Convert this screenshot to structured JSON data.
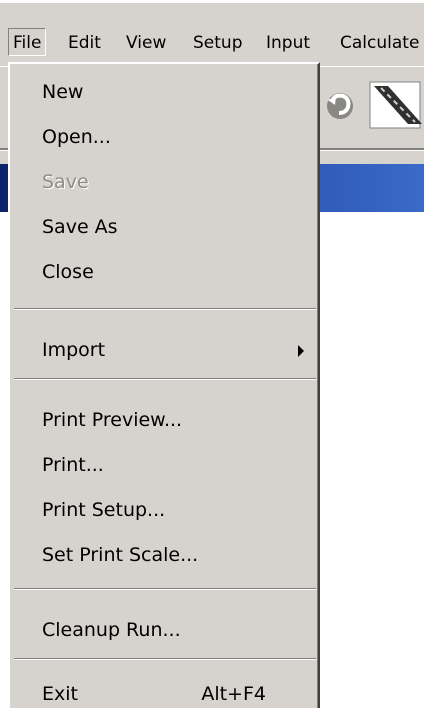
{
  "menubar": {
    "items": [
      {
        "label": "File"
      },
      {
        "label": "Edit"
      },
      {
        "label": "View"
      },
      {
        "label": "Setup"
      },
      {
        "label": "Input"
      },
      {
        "label": "Calculate"
      }
    ]
  },
  "toolbar": {
    "buttons": [
      {
        "icon": "undo-icon"
      },
      {
        "icon": "road-icon"
      }
    ]
  },
  "file_menu": {
    "items": [
      {
        "label": "New",
        "enabled": true
      },
      {
        "label": "Open...",
        "enabled": true
      },
      {
        "label": "Save",
        "enabled": false
      },
      {
        "label": "Save As",
        "enabled": true
      },
      {
        "label": "Close",
        "enabled": true
      },
      {
        "label": "Import",
        "enabled": true,
        "submenu": true
      },
      {
        "label": "Print Preview...",
        "enabled": true
      },
      {
        "label": "Print...",
        "enabled": true
      },
      {
        "label": "Print Setup...",
        "enabled": true
      },
      {
        "label": "Set Print Scale...",
        "enabled": true
      },
      {
        "label": "Cleanup Run...",
        "enabled": true
      },
      {
        "label": "Exit",
        "enabled": true,
        "shortcut": "Alt+F4"
      }
    ]
  },
  "colors": {
    "menu_bg": "#d6d3ce",
    "title_bar": "#0a246a",
    "disabled_text": "#8e8c87"
  }
}
